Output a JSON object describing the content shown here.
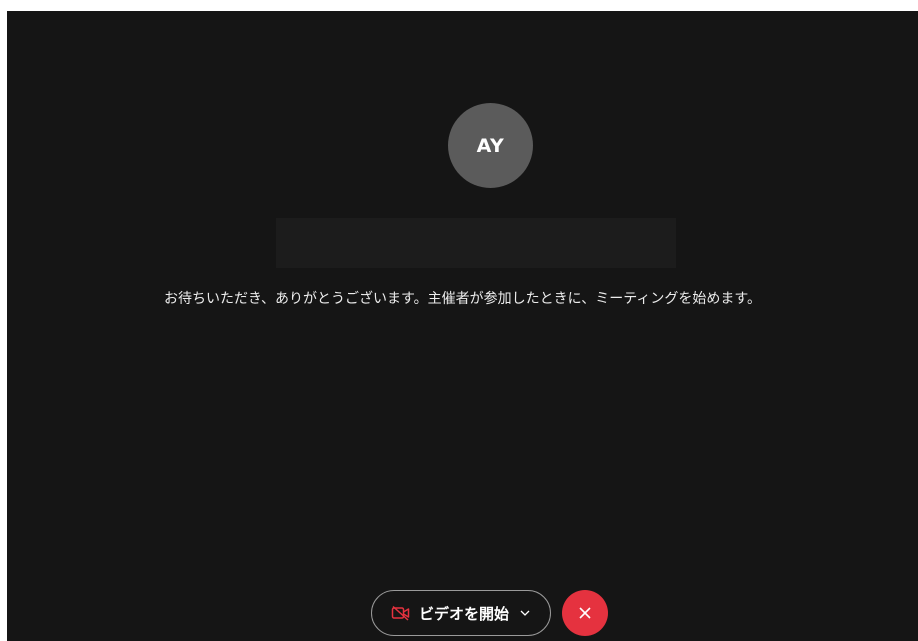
{
  "participant": {
    "initials": "AY",
    "name": ""
  },
  "lobby": {
    "message": "お待ちいただき、ありがとうございます。主催者が参加したときに、ミーティングを始めます。"
  },
  "controls": {
    "video_label": "ビデオを開始",
    "video_icon": "camera-off-icon",
    "dropdown_icon": "chevron-down-icon",
    "leave_icon": "close-icon"
  },
  "colors": {
    "background": "#151515",
    "avatar": "#5b5b5b",
    "leave_button": "#e5323f",
    "video_off_icon": "#e5323f"
  }
}
